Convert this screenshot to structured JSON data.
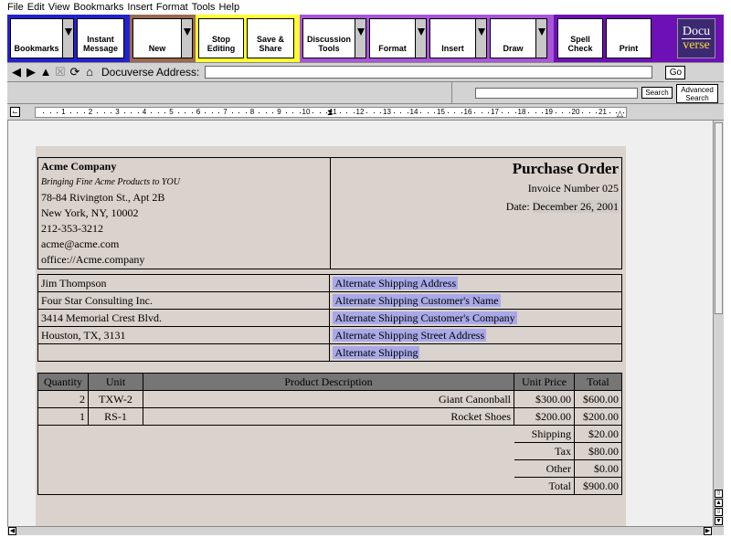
{
  "menu": [
    "File",
    "Edit",
    "View",
    "Bookmarks",
    "Insert",
    "Format",
    "Tools",
    "Help"
  ],
  "toolbar": {
    "bookmarks": "Bookmarks",
    "instant_message": "Instant\nMessage",
    "new": "New",
    "stop_editing": "Stop\nEditing",
    "save_share": "Save &\nShare",
    "discussion_tools": "Discussion\nTools",
    "format": "Format",
    "insert": "Insert",
    "draw": "Draw",
    "spell_check": "Spell\nCheck",
    "print": "Print",
    "logo_top": "Docu",
    "logo_bottom": "verse",
    "colors": {
      "bookmarks_group": "#2222cc",
      "new_group": "#9a6a50",
      "edit_group": "#ffff33",
      "tools_group": "#a855d8",
      "print_group": "#6d10b5"
    }
  },
  "address": {
    "label": "Docuverse Address:",
    "value": "",
    "go": "Go"
  },
  "search": {
    "value": "",
    "button": "Search",
    "advanced": "Advanced\nSearch"
  },
  "ruler": {
    "ticks": [
      "1",
      "2",
      "3",
      "4",
      "5",
      "6",
      "7",
      "8",
      "9",
      "10",
      "11",
      "12",
      "13",
      "14",
      "15",
      "16",
      "17",
      "18",
      "19",
      "20",
      "21"
    ]
  },
  "doc": {
    "company": {
      "name": "Acme Company",
      "slogan": "Bringing Fine Acme Products to YOU",
      "address1": "78-84 Rivington St., Apt 2B",
      "address2": "New York, NY, 10002",
      "phone": "212-353-3212",
      "email": "acme@acme.com",
      "office": "office://Acme.company"
    },
    "po": {
      "title": "Purchase Order",
      "invoice": "Invoice Number 025",
      "date_label": "Date:",
      "date_value": "December 26, 2001"
    },
    "billing": [
      {
        "left": "Jim Thompson",
        "right": "Alternate Shipping Address"
      },
      {
        "left": "Four Star Consulting Inc.",
        "right": "Alternate Shipping Customer's Name"
      },
      {
        "left": "3414 Memorial Crest Blvd.",
        "right": "Alternate Shipping Customer's Company"
      },
      {
        "left": "Houston, TX, 3131",
        "right": "Alternate Shipping Street Address"
      },
      {
        "left": "",
        "right": "Alternate Shipping"
      }
    ],
    "items_header": {
      "qty": "Quantity",
      "unit": "Unit",
      "desc": "Product Description",
      "price": "Unit Price",
      "total": "Total"
    },
    "items": [
      {
        "qty": "2",
        "unit": "TXW-2",
        "desc": "Giant Canonball",
        "price": "$300.00",
        "total": "$600.00"
      },
      {
        "qty": "1",
        "unit": "RS-1",
        "desc": "Rocket Shoes",
        "price": "$200.00",
        "total": "$200.00"
      }
    ],
    "summary": [
      {
        "label": "Shipping",
        "value": "$20.00"
      },
      {
        "label": "Tax",
        "value": "$80.00"
      },
      {
        "label": "Other",
        "value": "$0.00"
      },
      {
        "label": "Total",
        "value": "$900.00"
      }
    ]
  }
}
